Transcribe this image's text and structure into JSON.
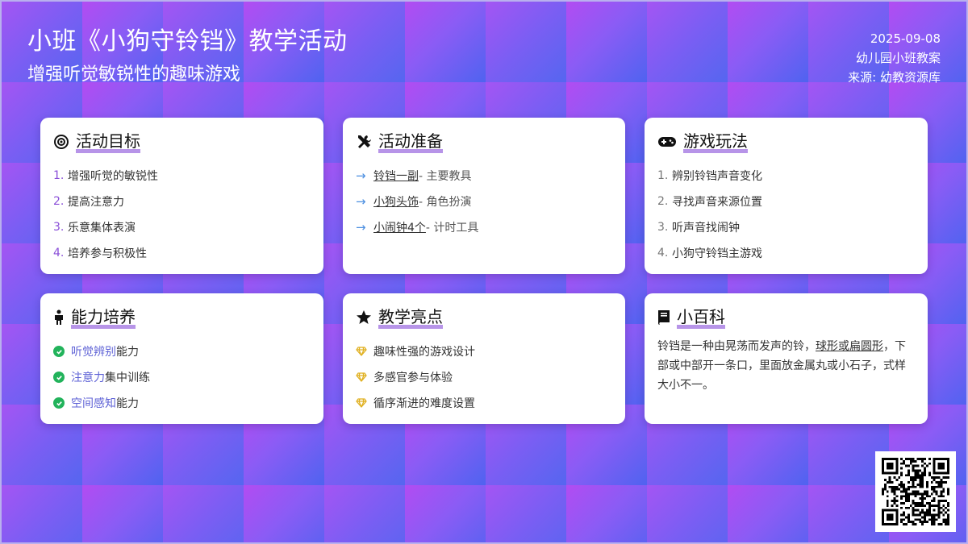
{
  "header": {
    "title": "小班《小狗守铃铛》教学活动",
    "subtitle": "增强听觉敏锐性的趣味游戏"
  },
  "meta": {
    "date": "2025-09-08",
    "category": "幼儿园小班教案",
    "source": "来源: 幼教资源库"
  },
  "cards": {
    "goals": {
      "title": "活动目标",
      "icon": "target-icon",
      "items": [
        {
          "num": "1.",
          "text": "增强听觉的敏锐性"
        },
        {
          "num": "2.",
          "text": "提高注意力"
        },
        {
          "num": "3.",
          "text": "乐意集体表演"
        },
        {
          "num": "4.",
          "text": "培养参与积极性"
        }
      ]
    },
    "prep": {
      "title": "活动准备",
      "icon": "tools-icon",
      "items": [
        {
          "link": "铃铛一副",
          "desc": " - 主要教具"
        },
        {
          "link": "小狗头饰",
          "desc": " - 角色扮演"
        },
        {
          "link": "小闹钟4个",
          "desc": " - 计时工具"
        }
      ]
    },
    "play": {
      "title": "游戏玩法",
      "icon": "gamepad-icon",
      "items": [
        {
          "num": "1.",
          "text": "辨别铃铛声音变化"
        },
        {
          "num": "2.",
          "text": "寻找声音来源位置"
        },
        {
          "num": "3.",
          "text": "听声音找闹钟"
        },
        {
          "num": "4.",
          "text": "小狗守铃铛主游戏"
        }
      ]
    },
    "ability": {
      "title": "能力培养",
      "icon": "child-icon",
      "items": [
        {
          "hl": "听觉辨别",
          "rest": "能力"
        },
        {
          "hl": "注意力",
          "rest": "集中训练"
        },
        {
          "hl": "空间感知",
          "rest": "能力"
        }
      ]
    },
    "highlights": {
      "title": "教学亮点",
      "icon": "star-icon",
      "items": [
        {
          "text": "趣味性强的游戏设计"
        },
        {
          "text": "多感官参与体验"
        },
        {
          "text": "循序渐进的难度设置"
        }
      ]
    },
    "wiki": {
      "title": "小百科",
      "icon": "book-icon",
      "p1": "铃铛是一种由晃荡而发声的铃，",
      "p_link": "球形或扁圆形",
      "p2": "，下部或中部开一条口，里面放金属丸或小石子，式样大小不一。"
    }
  },
  "colors": {
    "accent_purple": "#8a4fd8",
    "arrow_blue": "#4c8fe0",
    "check_green": "#22b35b",
    "gem_yellow": "#e0b020",
    "highlight_blue": "#5e62d6"
  }
}
